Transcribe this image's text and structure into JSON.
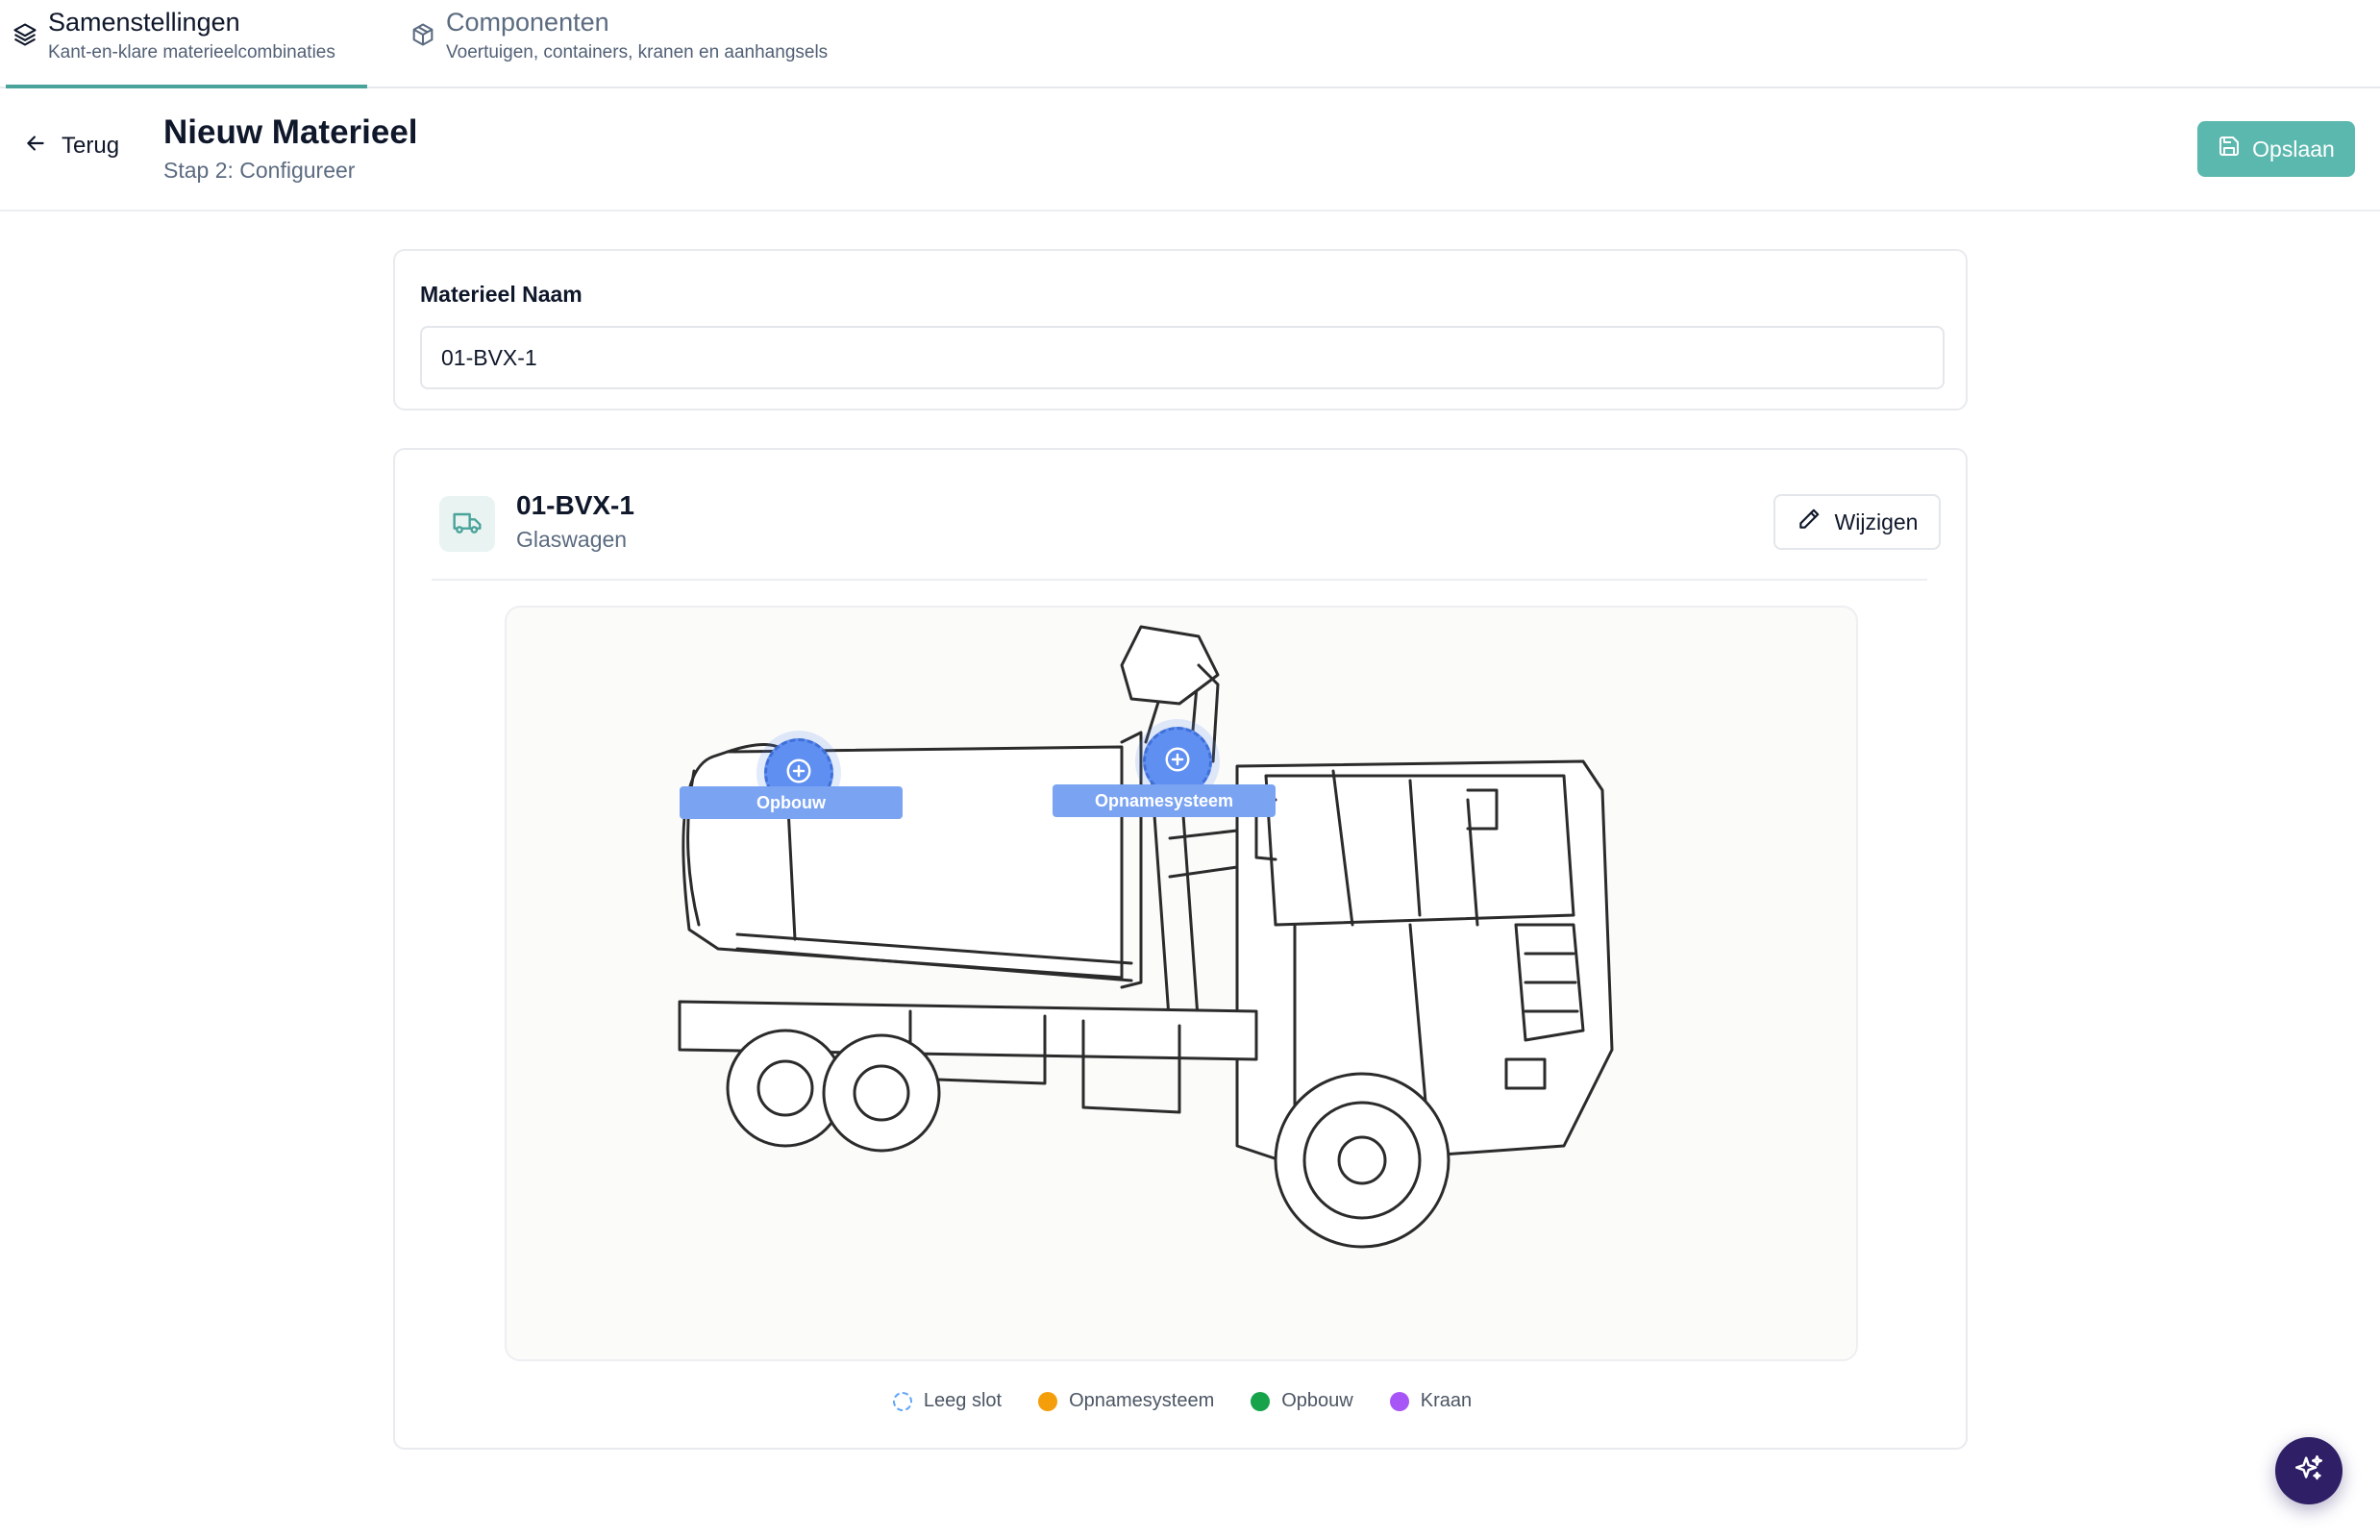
{
  "tabs": [
    {
      "title": "Samenstellingen",
      "subtitle": "Kant-en-klare materieelcombinaties",
      "icon": "layers-icon",
      "active": true
    },
    {
      "title": "Componenten",
      "subtitle": "Voertuigen, containers, kranen en aanhangsels",
      "icon": "package-icon",
      "active": false
    }
  ],
  "header": {
    "back_label": "Terug",
    "title": "Nieuw Materieel",
    "step": "Stap 2: Configureer",
    "save_label": "Opslaan"
  },
  "name_card": {
    "label": "Materieel Naam",
    "value": "01-BVX-1"
  },
  "material": {
    "code": "01-BVX-1",
    "type": "Glaswagen",
    "edit_label": "Wijzigen",
    "icon": "truck-icon",
    "slots": [
      {
        "label": "Opbouw",
        "state": "empty"
      },
      {
        "label": "Opnamesysteem",
        "state": "empty"
      }
    ]
  },
  "legend": [
    {
      "label": "Leeg slot",
      "color": "#60a5fa",
      "style": "dashed"
    },
    {
      "label": "Opnamesysteem",
      "color": "#f59e0b"
    },
    {
      "label": "Opbouw",
      "color": "#16a34a"
    },
    {
      "label": "Kraan",
      "color": "#a855f7"
    }
  ],
  "colors": {
    "accent": "#5bb8ae",
    "tab_underline": "#4aa39b",
    "slot": "#5f8ff0",
    "fab": "#2e1f66"
  }
}
